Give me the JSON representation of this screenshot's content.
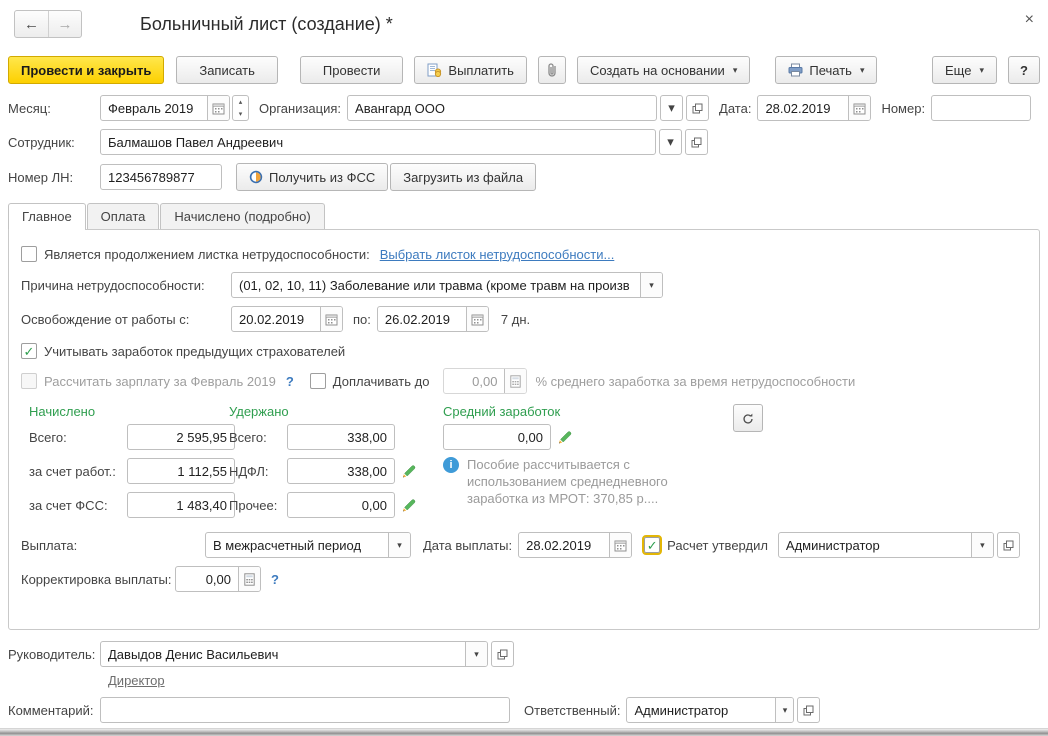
{
  "icons": {
    "back": "←",
    "forward": "→",
    "close": "×",
    "caret": "▾",
    "check": "✓",
    "spin_up": "▴",
    "spin_down": "▾",
    "info": "i"
  },
  "colors": {
    "accent_yellow": "#fdd000",
    "link_blue": "#3d7bbf",
    "section_green": "#2f9e4f",
    "disabled_text": "#9e9e9e"
  },
  "window": {
    "title": "Больничный лист (создание) *"
  },
  "toolbar": {
    "post_and_close": "Провести и закрыть",
    "save": "Записать",
    "post": "Провести",
    "pay": "Выплатить",
    "create_based_on": "Создать на основании",
    "print": "Печать",
    "more": "Еще",
    "help": "?"
  },
  "header_fields": {
    "month": {
      "label": "Месяц:",
      "value": "Февраль 2019"
    },
    "organization": {
      "label": "Организация:",
      "value": "Авангард ООО"
    },
    "date": {
      "label": "Дата:",
      "value": "28.02.2019"
    },
    "number": {
      "label": "Номер:",
      "value": ""
    },
    "employee": {
      "label": "Сотрудник:",
      "value": "Балмашов Павел Андреевич"
    },
    "ln_number": {
      "label": "Номер ЛН:",
      "value": "123456789877"
    },
    "get_from_fss": "Получить из ФСС",
    "load_from_file": "Загрузить из файла"
  },
  "tabs": {
    "main": "Главное",
    "payment": "Оплата",
    "accrued_detail": "Начислено (подробно)"
  },
  "main_tab": {
    "continuation_label": "Является продолжением листка нетрудоспособности:",
    "continuation_link": "Выбрать листок нетрудоспособности...",
    "reason_label": "Причина нетрудоспособности:",
    "reason_value": "(01, 02, 10, 11) Заболевание или травма (кроме травм на произв",
    "release_label": "Освобождение от работы с:",
    "release_from": "20.02.2019",
    "release_to_label": "по:",
    "release_to": "26.02.2019",
    "release_days": "7 дн.",
    "prev_insurers_label": "Учитывать заработок предыдущих страхователей",
    "calc_salary_label": "Рассчитать зарплату за Февраль 2019",
    "calc_salary_help": "?",
    "pay_up_to_label": "Доплачивать до",
    "pay_up_to_value": "0,00",
    "pay_up_to_suffix": "% среднего заработка за время нетрудоспособности",
    "accrued": {
      "header": "Начислено",
      "total_label": "Всего:",
      "total": "2 595,95",
      "employer_label": "за счет работ.:",
      "employer": "1 112,55",
      "fss_label": "за счет ФСС:",
      "fss": "1 483,40"
    },
    "withheld": {
      "header": "Удержано",
      "total_label": "Всего:",
      "total": "338,00",
      "ndfl_label": "НДФЛ:",
      "ndfl": "338,00",
      "other_label": "Прочее:",
      "other": "0,00"
    },
    "average": {
      "header": "Средний заработок",
      "value": "0,00"
    },
    "info_note": "Пособие рассчитывается с использованием среднедневного заработка из МРОТ: 370,85 р....",
    "payment_label": "Выплата:",
    "payment_value": "В межрасчетный период",
    "pay_date_label": "Дата выплаты:",
    "pay_date_value": "28.02.2019",
    "approved_label": "Расчет утвердил",
    "approved_value": "Администратор",
    "correction_label": "Корректировка выплаты:",
    "correction_value": "0,00",
    "correction_help": "?"
  },
  "footer": {
    "manager_label": "Руководитель:",
    "manager_value": "Давыдов Денис Васильевич",
    "manager_position_link": "Директор",
    "comment_label": "Комментарий:",
    "comment_value": "",
    "responsible_label": "Ответственный:",
    "responsible_value": "Администратор"
  }
}
